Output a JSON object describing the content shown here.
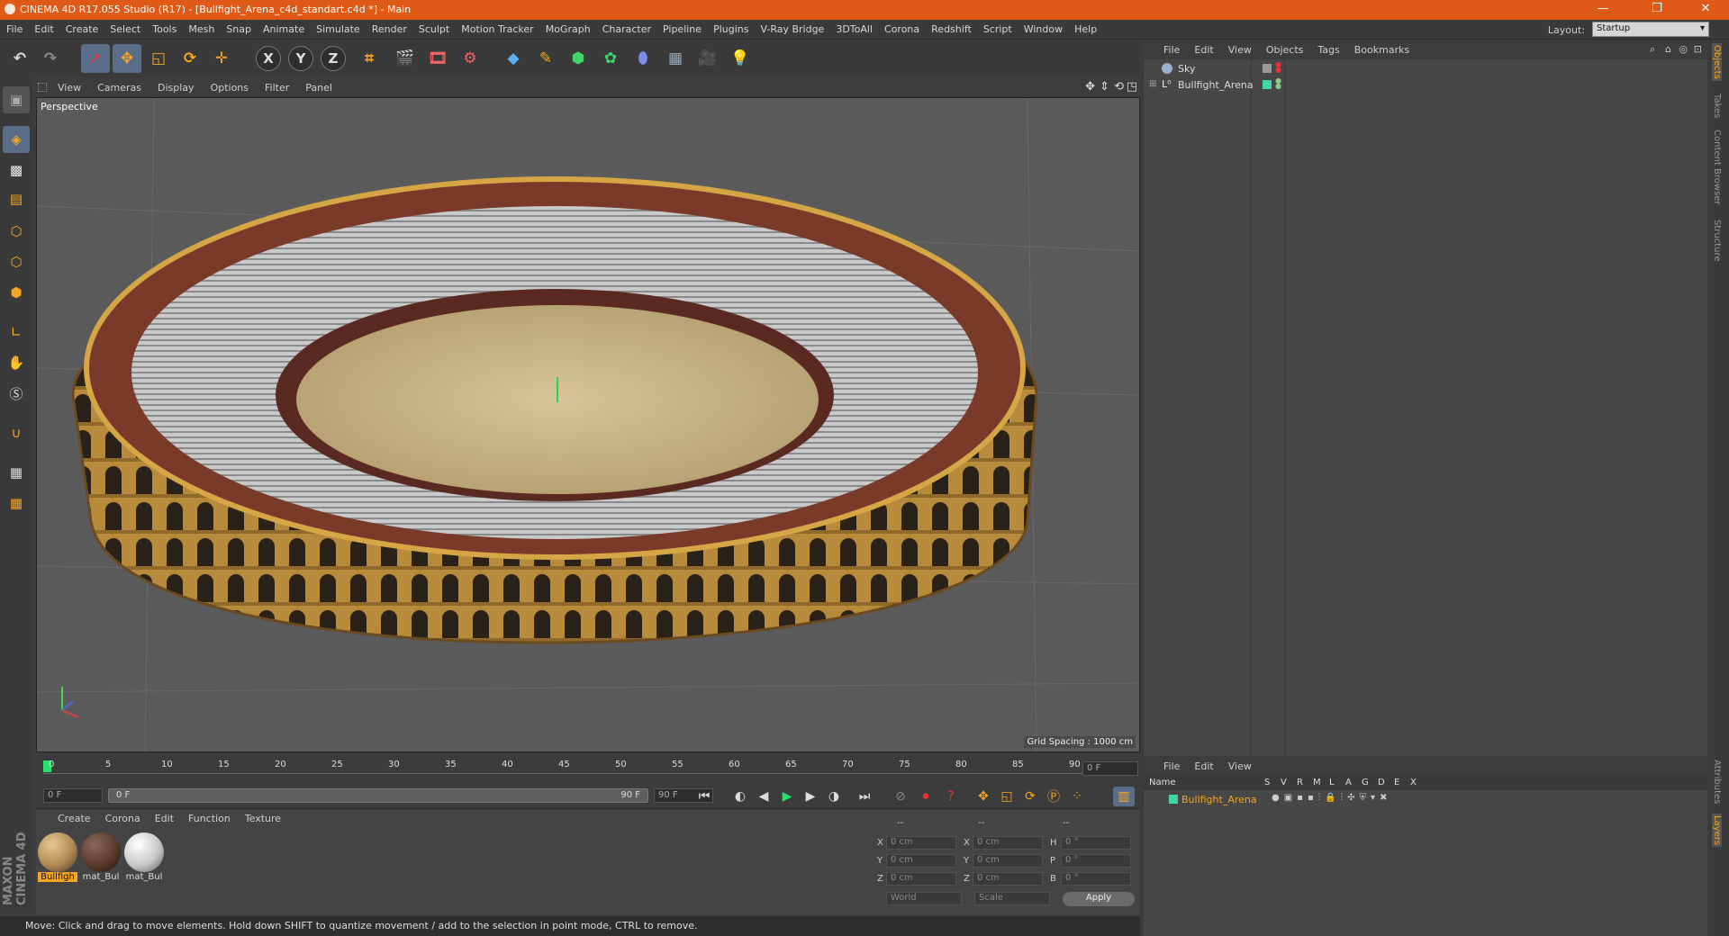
{
  "window": {
    "title": "CINEMA 4D R17.055 Studio (R17) - [Bullfight_Arena_c4d_standart.c4d *] - Main",
    "minimize": "—",
    "restore": "❐",
    "close": "✕"
  },
  "menu": [
    "File",
    "Edit",
    "Create",
    "Select",
    "Tools",
    "Mesh",
    "Snap",
    "Animate",
    "Simulate",
    "Render",
    "Sculpt",
    "Motion Tracker",
    "MoGraph",
    "Character",
    "Pipeline",
    "Plugins",
    "V-Ray Bridge",
    "3DToAll",
    "Corona",
    "Redshift",
    "Script",
    "Window",
    "Help"
  ],
  "layout": {
    "label": "Layout:",
    "value": "Startup"
  },
  "viewport": {
    "menu": [
      "View",
      "Cameras",
      "Display",
      "Options",
      "Filter",
      "Panel"
    ],
    "camera_label": "Perspective",
    "grid_spacing": "Grid Spacing : 1000 cm"
  },
  "timeline": {
    "ticks": [
      "0",
      "5",
      "10",
      "15",
      "20",
      "25",
      "30",
      "35",
      "40",
      "45",
      "50",
      "55",
      "60",
      "65",
      "70",
      "75",
      "80",
      "85",
      "90"
    ],
    "current_frame": "0 F",
    "start_field": "0 F",
    "range_start": "0 F",
    "range_end": "90 F",
    "end_field": "90 F"
  },
  "materials": {
    "menu": [
      "Create",
      "Corona",
      "Edit",
      "Function",
      "Texture"
    ],
    "items": [
      {
        "label": "Bullfigh",
        "selected": true,
        "color": "#b08a55"
      },
      {
        "label": "mat_Bul",
        "selected": false,
        "color": "#5a3a2a"
      },
      {
        "label": "mat_Bul",
        "selected": false,
        "color": "#c9c9c9"
      }
    ]
  },
  "coordinates": {
    "headers": [
      "--",
      "--",
      "--"
    ],
    "rows": [
      {
        "a": "X",
        "av": "0 cm",
        "b": "X",
        "bv": "0 cm",
        "c": "H",
        "cv": "0 °"
      },
      {
        "a": "Y",
        "av": "0 cm",
        "b": "Y",
        "bv": "0 cm",
        "c": "P",
        "cv": "0 °"
      },
      {
        "a": "Z",
        "av": "0 cm",
        "b": "Z",
        "bv": "0 cm",
        "c": "B",
        "cv": "0 °"
      }
    ],
    "mode1": "World",
    "mode2": "Scale",
    "apply": "Apply"
  },
  "status": "Move: Click and drag to move elements. Hold down SHIFT to quantize movement / add to the selection in point mode, CTRL to remove.",
  "objects": {
    "menu": [
      "File",
      "Edit",
      "View",
      "Objects",
      "Tags",
      "Bookmarks"
    ],
    "items": [
      {
        "name": "Sky",
        "tag_color": "#9a9a9a"
      },
      {
        "name": "Bullfight_Arena",
        "tag_color": "#3fd6a8"
      }
    ]
  },
  "layers": {
    "menu": [
      "File",
      "Edit",
      "View"
    ],
    "columns": [
      "Name",
      "S",
      "V",
      "R",
      "M",
      "L",
      "A",
      "G",
      "D",
      "E",
      "X"
    ],
    "items": [
      {
        "name": "Bullfight_Arena",
        "color": "#3fd6a8"
      }
    ]
  },
  "side_tabs": [
    "Objects",
    "Takes",
    "Content Browser",
    "Structure",
    "Attributes",
    "Layers"
  ],
  "brand": "MAXON CINEMA 4D"
}
